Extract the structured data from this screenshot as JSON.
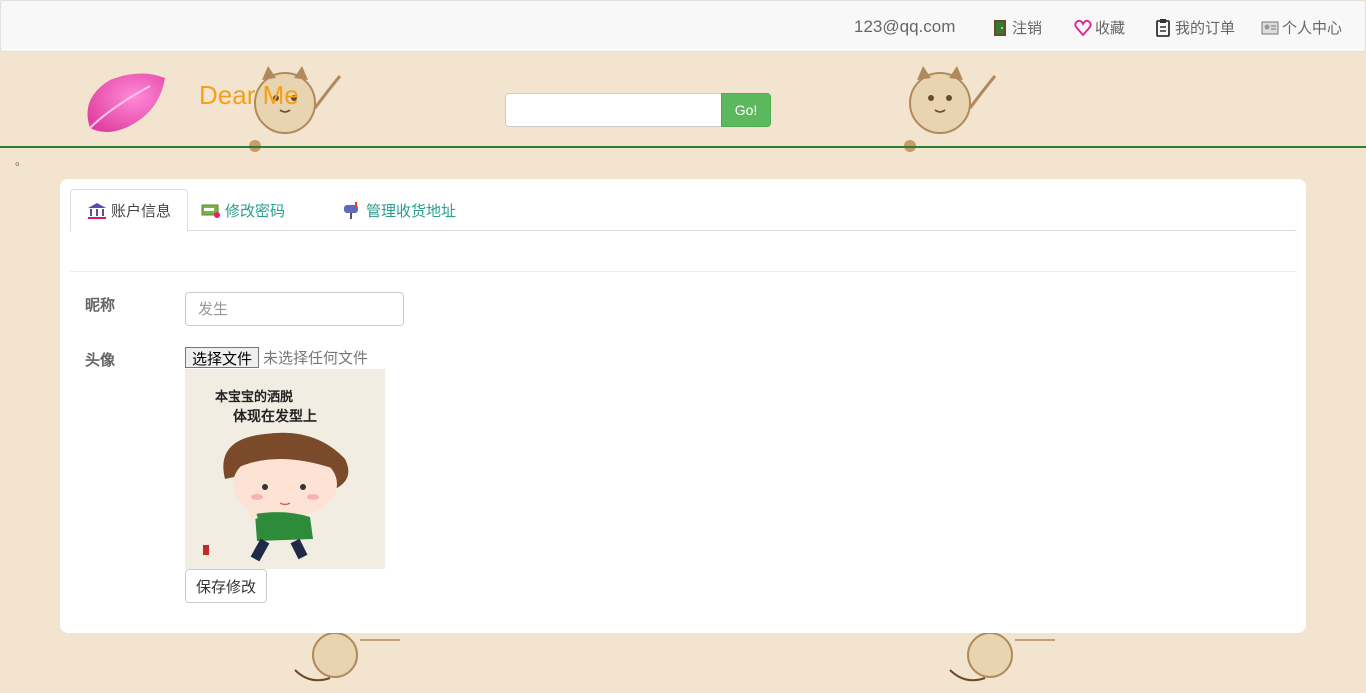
{
  "topnav": {
    "email": "123@qq.com",
    "items": [
      {
        "label": "注销",
        "icon": "logout-door-icon"
      },
      {
        "label": "收藏",
        "icon": "heart-icon"
      },
      {
        "label": "我的订单",
        "icon": "clipboard-icon"
      },
      {
        "label": "个人中心",
        "icon": "user-center-icon"
      }
    ]
  },
  "header": {
    "brand": "Dear Me",
    "search": {
      "value": "",
      "placeholder": "",
      "button": "Go!"
    },
    "dot": "。"
  },
  "tabs": [
    {
      "label": "账户信息",
      "icon": "bank-icon",
      "active": true
    },
    {
      "label": "修改密码",
      "icon": "password-card-icon",
      "active": false
    },
    {
      "label": "管理收货地址",
      "icon": "mailbox-icon",
      "active": false
    }
  ],
  "form": {
    "nickname_label": "昵称",
    "nickname_placeholder": "发生",
    "avatar_label": "头像",
    "file_button": "选择文件",
    "file_status": "未选择任何文件",
    "avatar_text_line1": "本宝宝的洒脱",
    "avatar_text_line2": "体现在发型上",
    "save_button": "保存修改"
  },
  "colors": {
    "brand": "#f5a01a",
    "search_button": "#5cb85c",
    "tab_link": "#2a9d8f",
    "header_line": "#2e7d32",
    "background": "#f2e4cf"
  }
}
